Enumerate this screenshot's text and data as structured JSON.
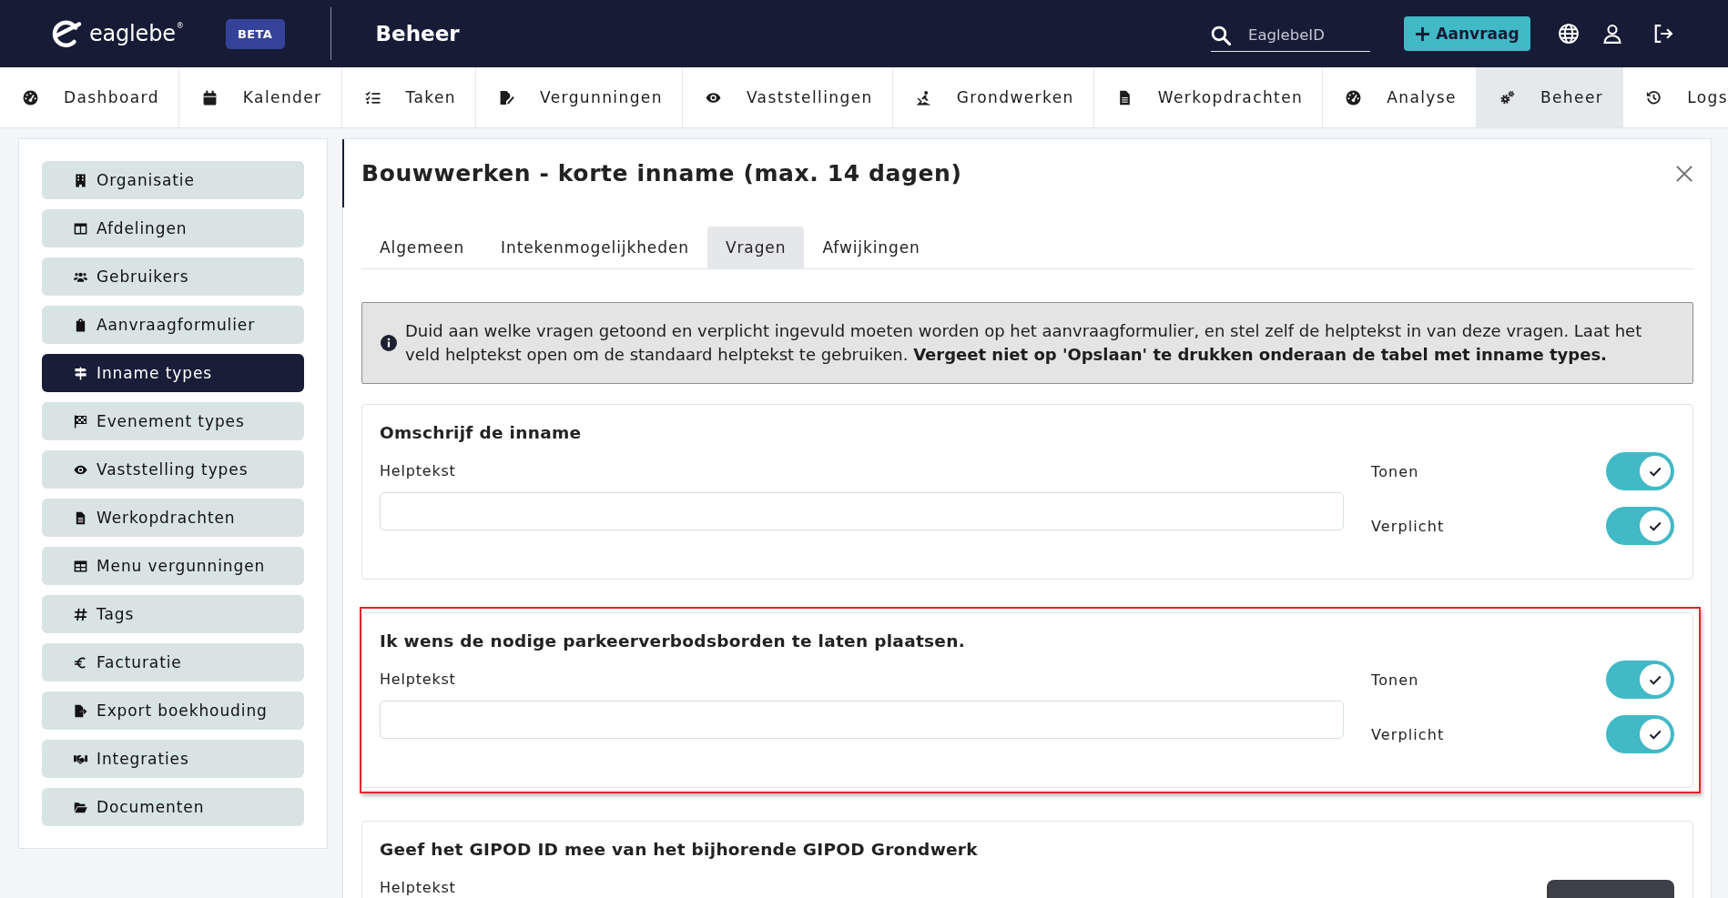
{
  "header": {
    "logo": "eaglebe$^{®}$",
    "badge": "BETA",
    "title": "Beheer",
    "search": {
      "placeholder": "EaglebeID"
    },
    "new_button": {
      "label": "Aanvraag"
    }
  },
  "nav": {
    "items": [
      {
        "label": "Dashboard",
        "selected": false
      },
      {
        "label": "Kalender",
        "selected": false
      },
      {
        "label": "Taken",
        "selected": false
      },
      {
        "label": "Vergunningen",
        "selected": false
      },
      {
        "label": "Vaststellingen",
        "selected": false
      },
      {
        "label": "Grondwerken",
        "selected": false
      },
      {
        "label": "Werkopdrachten",
        "selected": false
      },
      {
        "label": "Analyse",
        "selected": false
      },
      {
        "label": "Beheer",
        "selected": true
      },
      {
        "label": "Logs",
        "selected": false
      }
    ]
  },
  "sidebar": {
    "items": [
      {
        "label": "Organisatie",
        "selected": false
      },
      {
        "label": "Afdelingen",
        "selected": false
      },
      {
        "label": "Gebruikers",
        "selected": false
      },
      {
        "label": "Aanvraagformulier",
        "selected": false
      },
      {
        "label": "Inname types",
        "selected": true
      },
      {
        "label": "Evenement types",
        "selected": false
      },
      {
        "label": "Vaststelling types",
        "selected": false
      },
      {
        "label": "Werkopdrachten",
        "selected": false
      },
      {
        "label": "Menu vergunningen",
        "selected": false
      },
      {
        "label": "Tags",
        "selected": false
      },
      {
        "label": "Facturatie",
        "selected": false
      },
      {
        "label": "Export boekhouding",
        "selected": false
      },
      {
        "label": "Integraties",
        "selected": false
      },
      {
        "label": "Documenten",
        "selected": false
      }
    ]
  },
  "panel": {
    "title": "Bouwwerken - korte inname (max. 14 dagen)",
    "tabs": [
      {
        "label": "Algemeen",
        "selected": false
      },
      {
        "label": "Intekenmogelijkheden",
        "selected": false
      },
      {
        "label": "Vragen",
        "selected": true
      },
      {
        "label": "Afwijkingen",
        "selected": false
      }
    ],
    "info": "Duid aan welke vragen getoond en verplicht ingevuld moeten worden op het aanvraagformulier, en stel zelf de helptekst in van deze vragen. Laat het veld helptekst open om de standaard helptekst te gebruiken. **Vergeet niet op 'Opslaan' te drukken onderaan de tabel met inname types.**",
    "questions": [
      {
        "title": "Omschrijf de inname",
        "highlighted": false,
        "help_label": "Helptekst",
        "toggles": [
          {
            "label": "Tonen",
            "on": true
          },
          {
            "label": "Verplicht",
            "on": true
          }
        ]
      },
      {
        "title": "Ik wens de nodige parkeerverbodsborden te laten plaatsen.",
        "highlighted": true,
        "help_label": "Helptekst",
        "toggles": [
          {
            "label": "Tonen",
            "on": true
          },
          {
            "label": "Verplicht",
            "on": true
          }
        ]
      },
      {
        "title": "Geef het GIPOD ID mee van het bijhorende GIPOD Grondwerk",
        "highlighted": false,
        "help_label": "Helptekst"
      }
    ]
  }
}
